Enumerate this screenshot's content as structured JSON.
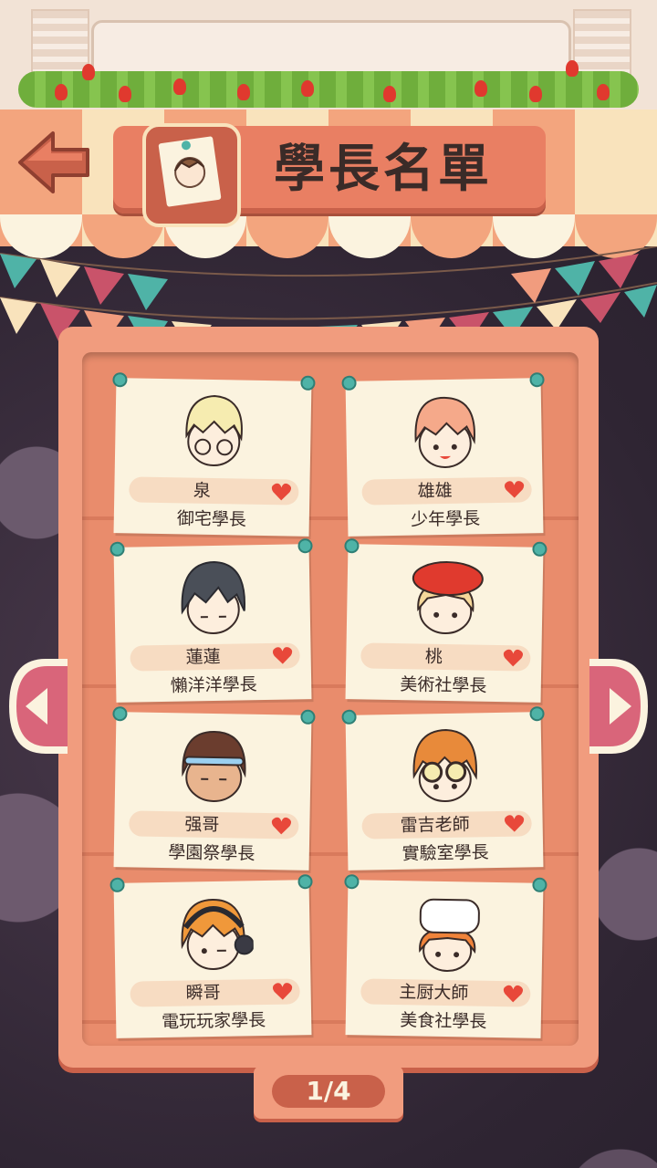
{
  "header": {
    "title": "學長名單"
  },
  "colors": {
    "accent": "#e97f63",
    "card": "#fbf3df",
    "heart": "#e8483a",
    "pin": "#4fb3a7"
  },
  "characters": [
    {
      "name": "泉",
      "title": "御宅學長",
      "icon": "blond-glasses-face-icon"
    },
    {
      "name": "雄雄",
      "title": "少年學長",
      "icon": "peach-hair-face-icon"
    },
    {
      "name": "蓮蓮",
      "title": "懶洋洋學長",
      "icon": "dark-hair-face-icon"
    },
    {
      "name": "桃",
      "title": "美術社學長",
      "icon": "red-beret-face-icon"
    },
    {
      "name": "强哥",
      "title": "學園祭學長",
      "icon": "headband-face-icon"
    },
    {
      "name": "雷吉老師",
      "title": "實驗室學長",
      "icon": "goggles-face-icon"
    },
    {
      "name": "瞬哥",
      "title": "電玩玩家學長",
      "icon": "headphones-face-icon"
    },
    {
      "name": "主厨大師",
      "title": "美食社學長",
      "icon": "chef-hat-face-icon"
    }
  ],
  "pagination": {
    "label": "1/4"
  }
}
